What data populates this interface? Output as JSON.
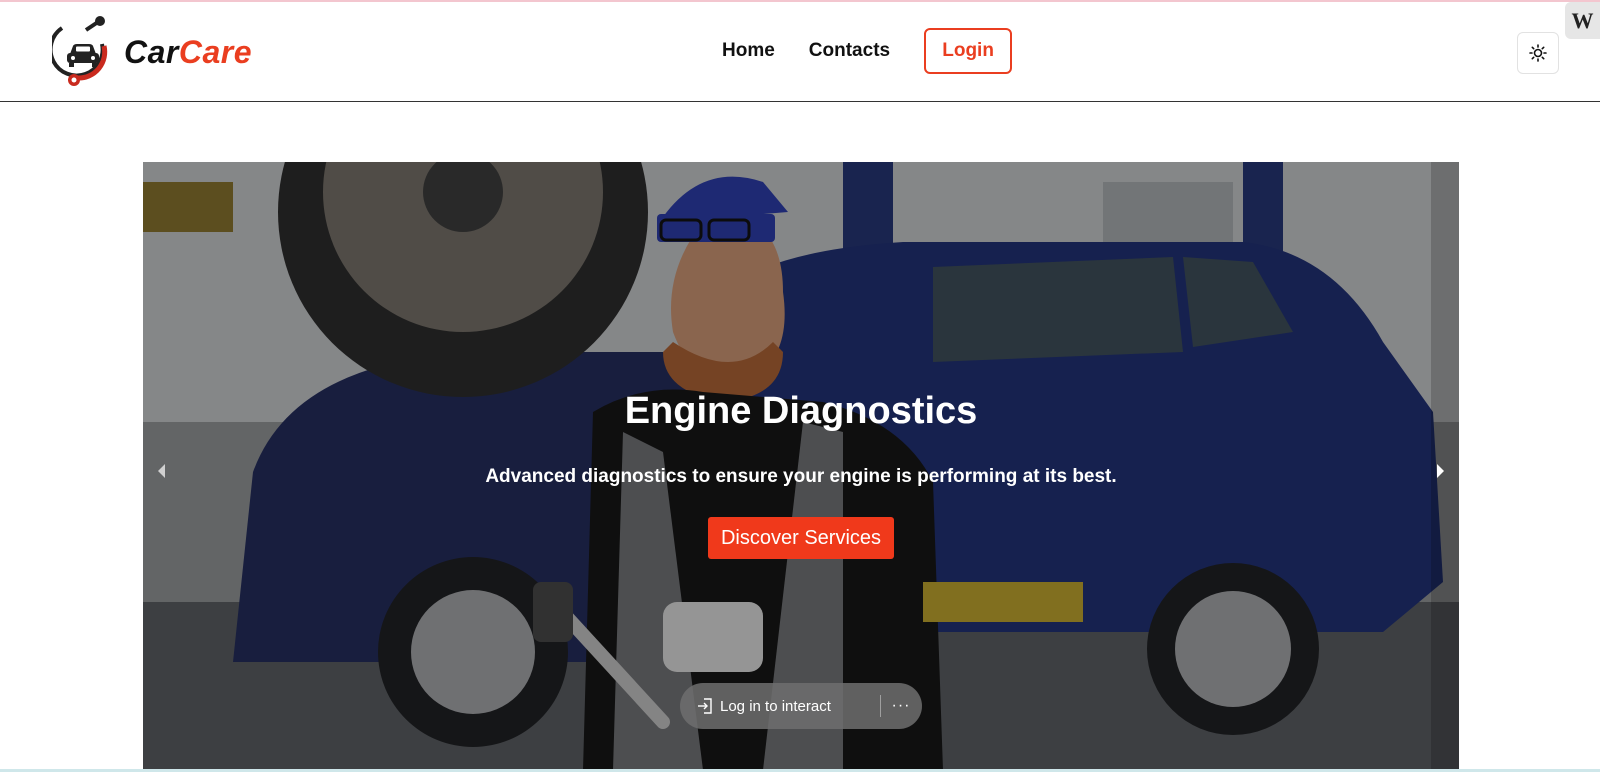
{
  "header": {
    "brand_part1": "Car",
    "brand_part2": "Care",
    "nav": [
      {
        "label": "Home"
      },
      {
        "label": "Contacts"
      }
    ],
    "login_label": "Login",
    "theme_icon": "sun-icon",
    "badge_text": "W"
  },
  "hero": {
    "title": "Engine Diagnostics",
    "subtitle": "Advanced diagnostics to ensure your engine is performing at its best.",
    "cta_label": "Discover Services",
    "prev_icon": "chevron-left-icon",
    "next_icon": "chevron-right-icon"
  },
  "overlay": {
    "login_prompt": "Log in to interact",
    "more_label": "···"
  },
  "colors": {
    "accent": "#ea3e20",
    "cta": "#f0391b",
    "text": "#111111"
  }
}
